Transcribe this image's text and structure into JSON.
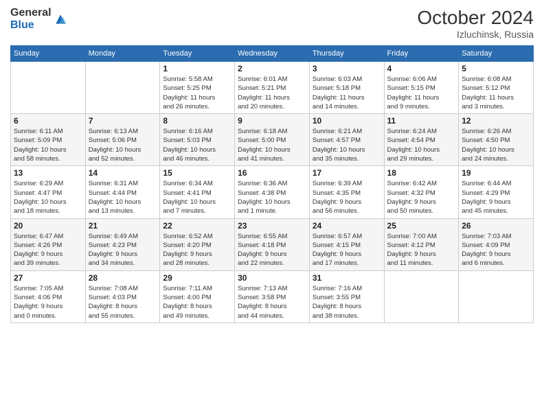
{
  "logo": {
    "general": "General",
    "blue": "Blue"
  },
  "title": "October 2024",
  "location": "Izluchinsk, Russia",
  "weekdays": [
    "Sunday",
    "Monday",
    "Tuesday",
    "Wednesday",
    "Thursday",
    "Friday",
    "Saturday"
  ],
  "days": [
    {
      "date": "",
      "info": ""
    },
    {
      "date": "",
      "info": ""
    },
    {
      "date": "1",
      "info": "Sunrise: 5:58 AM\nSunset: 5:25 PM\nDaylight: 11 hours\nand 26 minutes."
    },
    {
      "date": "2",
      "info": "Sunrise: 6:01 AM\nSunset: 5:21 PM\nDaylight: 11 hours\nand 20 minutes."
    },
    {
      "date": "3",
      "info": "Sunrise: 6:03 AM\nSunset: 5:18 PM\nDaylight: 11 hours\nand 14 minutes."
    },
    {
      "date": "4",
      "info": "Sunrise: 6:06 AM\nSunset: 5:15 PM\nDaylight: 11 hours\nand 9 minutes."
    },
    {
      "date": "5",
      "info": "Sunrise: 6:08 AM\nSunset: 5:12 PM\nDaylight: 11 hours\nand 3 minutes."
    },
    {
      "date": "6",
      "info": "Sunrise: 6:11 AM\nSunset: 5:09 PM\nDaylight: 10 hours\nand 58 minutes."
    },
    {
      "date": "7",
      "info": "Sunrise: 6:13 AM\nSunset: 5:06 PM\nDaylight: 10 hours\nand 52 minutes."
    },
    {
      "date": "8",
      "info": "Sunrise: 6:16 AM\nSunset: 5:03 PM\nDaylight: 10 hours\nand 46 minutes."
    },
    {
      "date": "9",
      "info": "Sunrise: 6:18 AM\nSunset: 5:00 PM\nDaylight: 10 hours\nand 41 minutes."
    },
    {
      "date": "10",
      "info": "Sunrise: 6:21 AM\nSunset: 4:57 PM\nDaylight: 10 hours\nand 35 minutes."
    },
    {
      "date": "11",
      "info": "Sunrise: 6:24 AM\nSunset: 4:54 PM\nDaylight: 10 hours\nand 29 minutes."
    },
    {
      "date": "12",
      "info": "Sunrise: 6:26 AM\nSunset: 4:50 PM\nDaylight: 10 hours\nand 24 minutes."
    },
    {
      "date": "13",
      "info": "Sunrise: 6:29 AM\nSunset: 4:47 PM\nDaylight: 10 hours\nand 18 minutes."
    },
    {
      "date": "14",
      "info": "Sunrise: 6:31 AM\nSunset: 4:44 PM\nDaylight: 10 hours\nand 13 minutes."
    },
    {
      "date": "15",
      "info": "Sunrise: 6:34 AM\nSunset: 4:41 PM\nDaylight: 10 hours\nand 7 minutes."
    },
    {
      "date": "16",
      "info": "Sunrise: 6:36 AM\nSunset: 4:38 PM\nDaylight: 10 hours\nand 1 minute."
    },
    {
      "date": "17",
      "info": "Sunrise: 6:39 AM\nSunset: 4:35 PM\nDaylight: 9 hours\nand 56 minutes."
    },
    {
      "date": "18",
      "info": "Sunrise: 6:42 AM\nSunset: 4:32 PM\nDaylight: 9 hours\nand 50 minutes."
    },
    {
      "date": "19",
      "info": "Sunrise: 6:44 AM\nSunset: 4:29 PM\nDaylight: 9 hours\nand 45 minutes."
    },
    {
      "date": "20",
      "info": "Sunrise: 6:47 AM\nSunset: 4:26 PM\nDaylight: 9 hours\nand 39 minutes."
    },
    {
      "date": "21",
      "info": "Sunrise: 6:49 AM\nSunset: 4:23 PM\nDaylight: 9 hours\nand 34 minutes."
    },
    {
      "date": "22",
      "info": "Sunrise: 6:52 AM\nSunset: 4:20 PM\nDaylight: 9 hours\nand 28 minutes."
    },
    {
      "date": "23",
      "info": "Sunrise: 6:55 AM\nSunset: 4:18 PM\nDaylight: 9 hours\nand 22 minutes."
    },
    {
      "date": "24",
      "info": "Sunrise: 6:57 AM\nSunset: 4:15 PM\nDaylight: 9 hours\nand 17 minutes."
    },
    {
      "date": "25",
      "info": "Sunrise: 7:00 AM\nSunset: 4:12 PM\nDaylight: 9 hours\nand 11 minutes."
    },
    {
      "date": "26",
      "info": "Sunrise: 7:03 AM\nSunset: 4:09 PM\nDaylight: 9 hours\nand 6 minutes."
    },
    {
      "date": "27",
      "info": "Sunrise: 7:05 AM\nSunset: 4:06 PM\nDaylight: 9 hours\nand 0 minutes."
    },
    {
      "date": "28",
      "info": "Sunrise: 7:08 AM\nSunset: 4:03 PM\nDaylight: 8 hours\nand 55 minutes."
    },
    {
      "date": "29",
      "info": "Sunrise: 7:11 AM\nSunset: 4:00 PM\nDaylight: 8 hours\nand 49 minutes."
    },
    {
      "date": "30",
      "info": "Sunrise: 7:13 AM\nSunset: 3:58 PM\nDaylight: 8 hours\nand 44 minutes."
    },
    {
      "date": "31",
      "info": "Sunrise: 7:16 AM\nSunset: 3:55 PM\nDaylight: 8 hours\nand 38 minutes."
    },
    {
      "date": "",
      "info": ""
    },
    {
      "date": "",
      "info": ""
    }
  ]
}
